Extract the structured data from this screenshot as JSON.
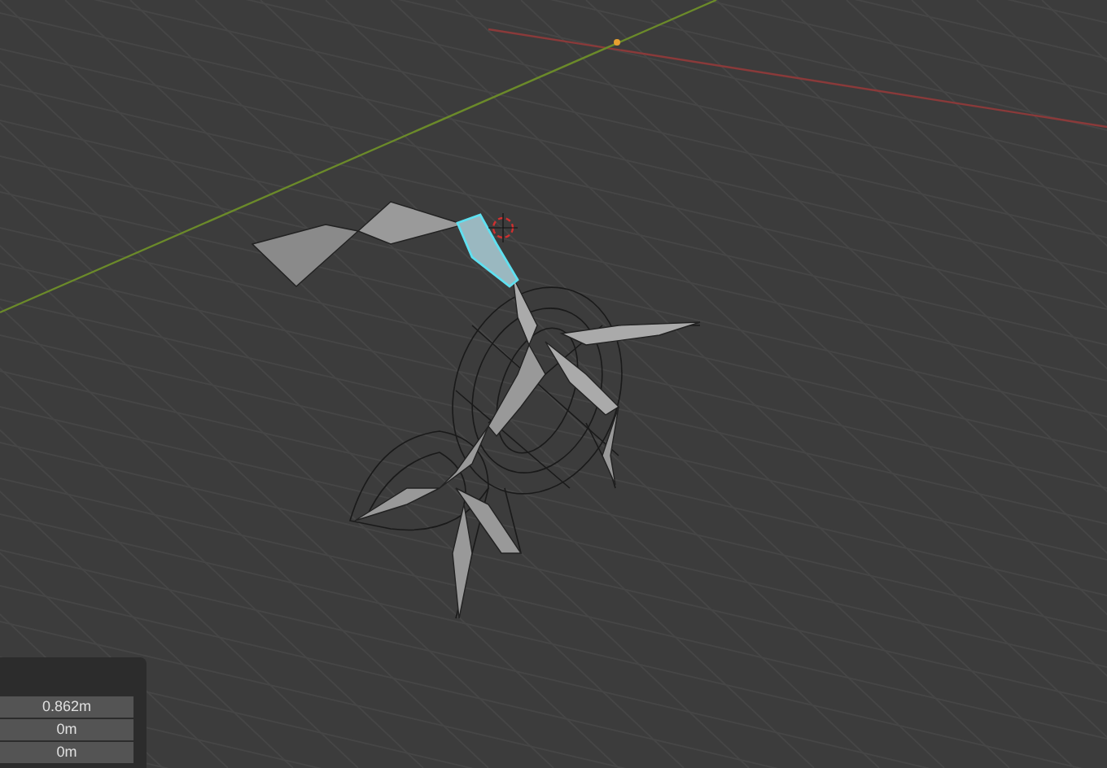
{
  "panel": {
    "fields": [
      {
        "value": "0.862m"
      },
      {
        "value": "0m"
      },
      {
        "value": "0m"
      }
    ]
  }
}
